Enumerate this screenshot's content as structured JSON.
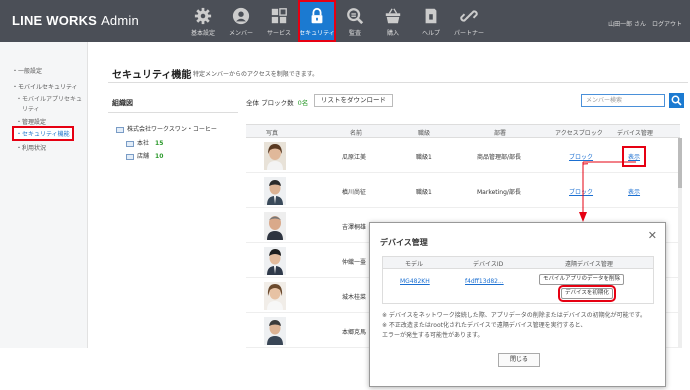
{
  "header": {
    "logo_main": "LINE WORKS",
    "logo_sub": "Admin",
    "nav": [
      {
        "label": "基本設定",
        "icon": "gear-icon"
      },
      {
        "label": "メンバー",
        "icon": "person-icon"
      },
      {
        "label": "サービス",
        "icon": "grid-icon"
      },
      {
        "label": "セキュリティ",
        "icon": "lock-icon"
      },
      {
        "label": "監査",
        "icon": "magnifier-icon"
      },
      {
        "label": "購入",
        "icon": "basket-icon"
      },
      {
        "label": "ヘルプ",
        "icon": "book-icon"
      },
      {
        "label": "パートナー",
        "icon": "link-icon"
      }
    ],
    "user_name": "山田一郎 さん",
    "logout": "ログアウト"
  },
  "sidebar": {
    "items": [
      {
        "label": "・一般設定"
      },
      {
        "label": "・モバイルセキュリティ"
      },
      {
        "label": "・モバイルアプリセキュ"
      },
      {
        "label": "リティ"
      },
      {
        "label": "・管理設定"
      },
      {
        "label": "・セキュリティ機能"
      },
      {
        "label": "・利用状況"
      }
    ]
  },
  "page": {
    "title": "セキュリティ機能",
    "description": "特定メンバーからのアクセスを制限できます。"
  },
  "org": {
    "title": "組織図",
    "root": "株式会社ワークスワン・コーヒー",
    "children": [
      {
        "name": "本社",
        "count": "15"
      },
      {
        "name": "店舗",
        "count": "10"
      }
    ]
  },
  "toolbar": {
    "block_label": "全体 ブロック数",
    "block_count": "0名",
    "download_label": "リストをダウンロード",
    "search_placeholder": "メンバー検索"
  },
  "table": {
    "headers": [
      "写真",
      "名前",
      "職級",
      "部署",
      "アクセスブロック",
      "デバイス管理"
    ],
    "rows": [
      {
        "name": "瓜原江美",
        "rank": "職級1",
        "dept": "商品管理部/部長",
        "block": "ブロック",
        "device": "表示"
      },
      {
        "name": "槙川尚征",
        "rank": "職級1",
        "dept": "Marketing/部長",
        "block": "ブロック",
        "device": "表示"
      },
      {
        "name": "吉澤桐雄",
        "rank": "",
        "dept": "",
        "block": "",
        "device": ""
      },
      {
        "name": "仲織一臺",
        "rank": "",
        "dept": "",
        "block": "",
        "device": ""
      },
      {
        "name": "城木桂菜",
        "rank": "",
        "dept": "",
        "block": "",
        "device": ""
      },
      {
        "name": "本郷克馬",
        "rank": "",
        "dept": "",
        "block": "",
        "device": ""
      }
    ]
  },
  "modal": {
    "title": "デバイス管理",
    "headers": [
      "モデル",
      "デバイスID",
      "遠隔デバイス管理"
    ],
    "model": "MG482KH",
    "device_id": "f4dff13d82...",
    "btn_wipe_app": "モバイルアプリのデータを削除",
    "btn_reset_device": "デバイスを初期化",
    "notes": [
      "※ デバイスをネットワーク接続した際、アプリデータの削除またはデバイスの初期化が可能です。",
      "※ 不正改造またはroot化されたデバイスで遠隔デバイス管理を実行すると、",
      "エラーが発生する可能性があります。"
    ],
    "close_label": "閉じる"
  },
  "colors": {
    "header_bg": "#4b4f57",
    "accent": "#1b7ad1",
    "highlight": "#e60012"
  }
}
